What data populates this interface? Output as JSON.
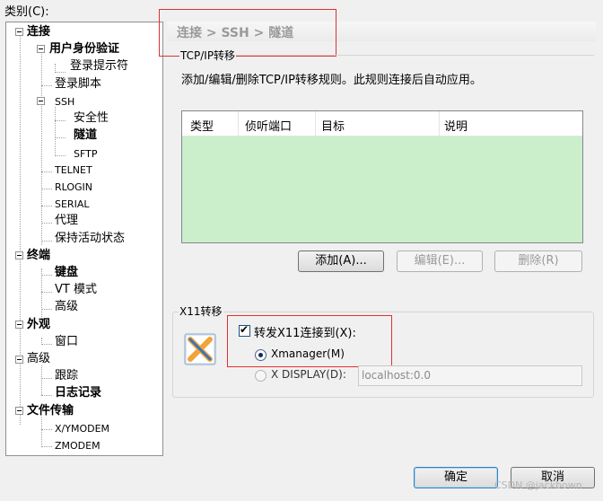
{
  "category_label": "类别(C):",
  "tree": {
    "items": [
      {
        "label": "连接",
        "bold": true
      },
      {
        "label": "用户身份验证",
        "bold": true
      },
      {
        "label": "登录提示符"
      },
      {
        "label": "登录脚本"
      },
      {
        "label": "SSH"
      },
      {
        "label": "安全性"
      },
      {
        "label": "隧道",
        "bold": true,
        "selected": true
      },
      {
        "label": "SFTP"
      },
      {
        "label": "TELNET"
      },
      {
        "label": "RLOGIN"
      },
      {
        "label": "SERIAL"
      },
      {
        "label": "代理"
      },
      {
        "label": "保持活动状态"
      },
      {
        "label": "终端",
        "bold": true
      },
      {
        "label": "键盘",
        "bold": true
      },
      {
        "label": "VT 模式"
      },
      {
        "label": "高级"
      },
      {
        "label": "外观",
        "bold": true
      },
      {
        "label": "窗口"
      },
      {
        "label": "高级"
      },
      {
        "label": "跟踪"
      },
      {
        "label": "日志记录",
        "bold": true
      },
      {
        "label": "文件传输",
        "bold": true
      },
      {
        "label": "X/YMODEM"
      },
      {
        "label": "ZMODEM"
      }
    ]
  },
  "breadcrumb": "连接 > SSH > 隧道",
  "tcpip": {
    "group_title": "TCP/IP转移",
    "description": "添加/编辑/删除TCP/IP转移规则。此规则连接后自动应用。",
    "columns": [
      "类型",
      "侦听端口",
      "目标",
      "说明"
    ],
    "add_label": "添加(A)...",
    "edit_label": "编辑(E)...",
    "delete_label": "删除(R)"
  },
  "x11": {
    "group_title": "X11转移",
    "forward_label": "转发X11连接到(X):",
    "forward_checked": true,
    "xmanager_label": "Xmanager(M)",
    "xdisplay_label": "X DISPLAY(D):",
    "xdisplay_value": "localhost:0.0"
  },
  "buttons": {
    "ok": "确定",
    "cancel": "取消"
  },
  "watermark": "CSDN @jackbown"
}
